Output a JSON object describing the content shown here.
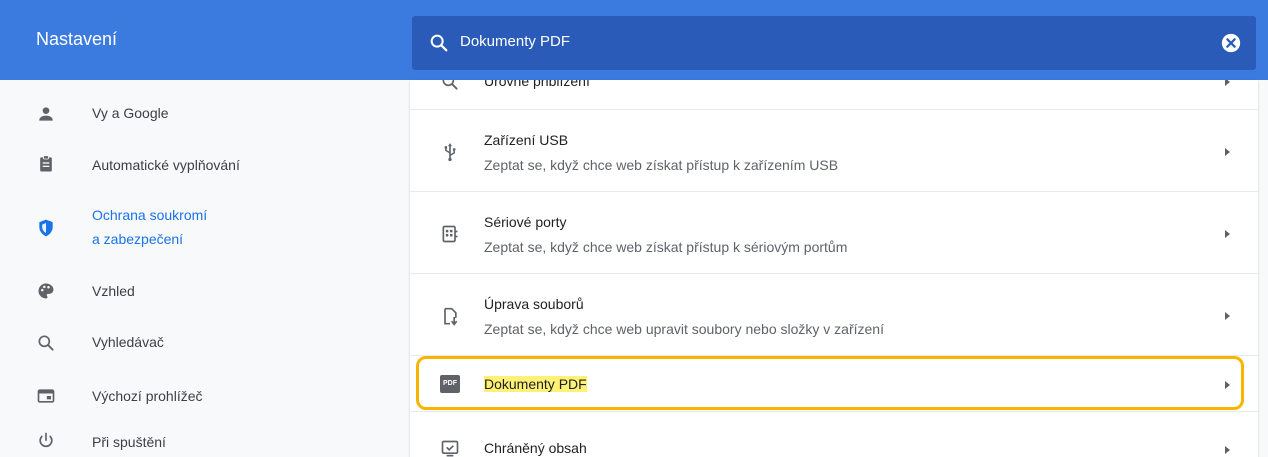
{
  "header": {
    "title": "Nastavení",
    "search": {
      "value": "Dokumenty PDF"
    }
  },
  "sidebar": {
    "items": [
      {
        "label": "Vy a Google",
        "icon": "person-icon"
      },
      {
        "label": "Automatické vyplňování",
        "icon": "clipboard-icon"
      },
      {
        "label_line1": "Ochrana soukromí",
        "label_line2": "a zabezpečení",
        "icon": "shield-icon",
        "active": true
      },
      {
        "label": "Vzhled",
        "icon": "palette-icon"
      },
      {
        "label": "Vyhledávač",
        "icon": "search-icon"
      },
      {
        "label": "Výchozí prohlížeč",
        "icon": "browser-window-icon"
      },
      {
        "label": "Při spuštění",
        "icon": "power-icon"
      }
    ]
  },
  "main": {
    "rows": [
      {
        "title": "Úrovně přiblížení",
        "icon": "zoom-icon"
      },
      {
        "title": "Zařízení USB",
        "subtitle": "Zeptat se, když chce web získat přístup k zařízením USB",
        "icon": "usb-icon"
      },
      {
        "title": "Sériové porty",
        "subtitle": "Zeptat se, když chce web získat přístup k sériovým portům",
        "icon": "serial-port-icon"
      },
      {
        "title": "Úprava souborů",
        "subtitle": "Zeptat se, když chce web upravit soubory nebo složky v zařízení",
        "icon": "file-edit-icon"
      },
      {
        "title": "Dokumenty PDF",
        "icon": "pdf-icon",
        "pdf_badge": "PDF",
        "highlighted": true
      },
      {
        "title": "Chráněný obsah",
        "icon": "protected-content-icon"
      }
    ]
  },
  "colors": {
    "header": "#3b7be0",
    "search": "#2a5bb8",
    "accent": "#1a73e8",
    "focus": "#f7b500",
    "highlight": "#fff176"
  }
}
